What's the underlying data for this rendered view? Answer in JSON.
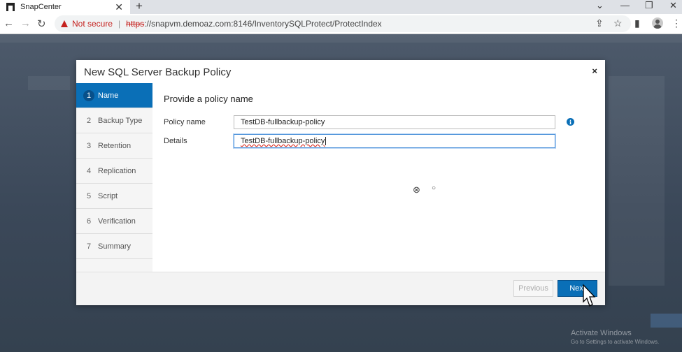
{
  "browser": {
    "tab_title": "SnapCenter",
    "tab_close": "✕",
    "new_tab": "+",
    "not_secure": "Not secure",
    "url_scheme": "https",
    "url_rest": "://snapvm.demoaz.com:8146/InventorySQLProtect/ProtectIndex"
  },
  "modal": {
    "title": "New SQL Server Backup Policy",
    "close": "×",
    "steps": [
      {
        "num": "1",
        "label": "Name"
      },
      {
        "num": "2",
        "label": "Backup Type"
      },
      {
        "num": "3",
        "label": "Retention"
      },
      {
        "num": "4",
        "label": "Replication"
      },
      {
        "num": "5",
        "label": "Script"
      },
      {
        "num": "6",
        "label": "Verification"
      },
      {
        "num": "7",
        "label": "Summary"
      }
    ],
    "active_step": 0,
    "section_title": "Provide a policy name",
    "policy_name_label": "Policy name",
    "policy_name_value": "TestDB-fullbackup-policy",
    "details_label": "Details",
    "details_value": "TestDB-fullbackup-policy",
    "info_icon": "i",
    "previous_label": "Previous",
    "next_label": "Next"
  },
  "activate_windows": {
    "title": "Activate Windows",
    "subtitle": "Go to Settings to activate Windows."
  },
  "colors": {
    "accent": "#0a6fb7",
    "warning": "#c5221f"
  }
}
